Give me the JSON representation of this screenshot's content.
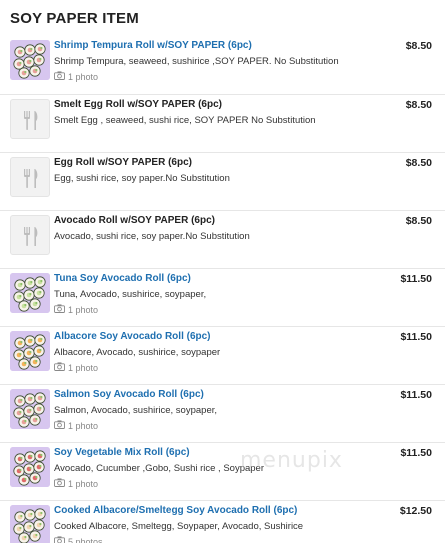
{
  "section": {
    "title": "SOY PAPER ITEM"
  },
  "items": [
    {
      "name": "Shrimp Tempura Roll w/SOY PAPER (6pc)",
      "description": "Shrimp Tempura, seaweed, sushirice ,SOY PAPER. No Substitution",
      "price": "$8.50",
      "photos": "1 photo",
      "has_photo": true,
      "linked": true
    },
    {
      "name": "Smelt Egg Roll w/SOY PAPER (6pc)",
      "description": "Smelt Egg , seaweed,  sushi rice, SOY PAPER No Substitution",
      "price": "$8.50",
      "photos": "",
      "has_photo": false,
      "linked": false
    },
    {
      "name": "Egg Roll w/SOY PAPER (6pc)",
      "description": "Egg, sushi rice, soy paper.No Substitution",
      "price": "$8.50",
      "photos": "",
      "has_photo": false,
      "linked": false
    },
    {
      "name": "Avocado Roll w/SOY PAPER (6pc)",
      "description": "Avocado, sushi rice, soy paper.No Substitution",
      "price": "$8.50",
      "photos": "",
      "has_photo": false,
      "linked": false
    },
    {
      "name": "Tuna Soy Avocado Roll (6pc)",
      "description": "Tuna, Avocado, sushirice, soypaper,",
      "price": "$11.50",
      "photos": "1 photo",
      "has_photo": true,
      "linked": true
    },
    {
      "name": "Albacore Soy Avocado Roll (6pc)",
      "description": "Albacore, Avocado, sushirice, soypaper",
      "price": "$11.50",
      "photos": "1 photo",
      "has_photo": true,
      "linked": true
    },
    {
      "name": "Salmon Soy Avocado Roll (6pc)",
      "description": "Salmon, Avocado, sushirice, soypaper,",
      "price": "$11.50",
      "photos": "1 photo",
      "has_photo": true,
      "linked": true
    },
    {
      "name": "Soy Vegetable Mix Roll (6pc)",
      "description": "Avocado, Cucumber ,Gobo, Sushi rice , Soypaper",
      "price": "$11.50",
      "photos": "1 photo",
      "has_photo": true,
      "linked": true
    },
    {
      "name": "Cooked Albacore/Smeltegg Soy Avocado Roll (6pc)",
      "description": "Cooked Albacore, Smeltegg, Soypaper, Avocado, Sushirice",
      "price": "$12.50",
      "photos": "5 photos",
      "has_photo": true,
      "linked": true
    }
  ],
  "icons": {
    "placeholder": "fork-knife-icon",
    "photo_count": "camera-icon"
  },
  "colors": {
    "link": "#1e6fb0",
    "thumb_bg": "#d9c9f0"
  },
  "watermark": "menupix"
}
